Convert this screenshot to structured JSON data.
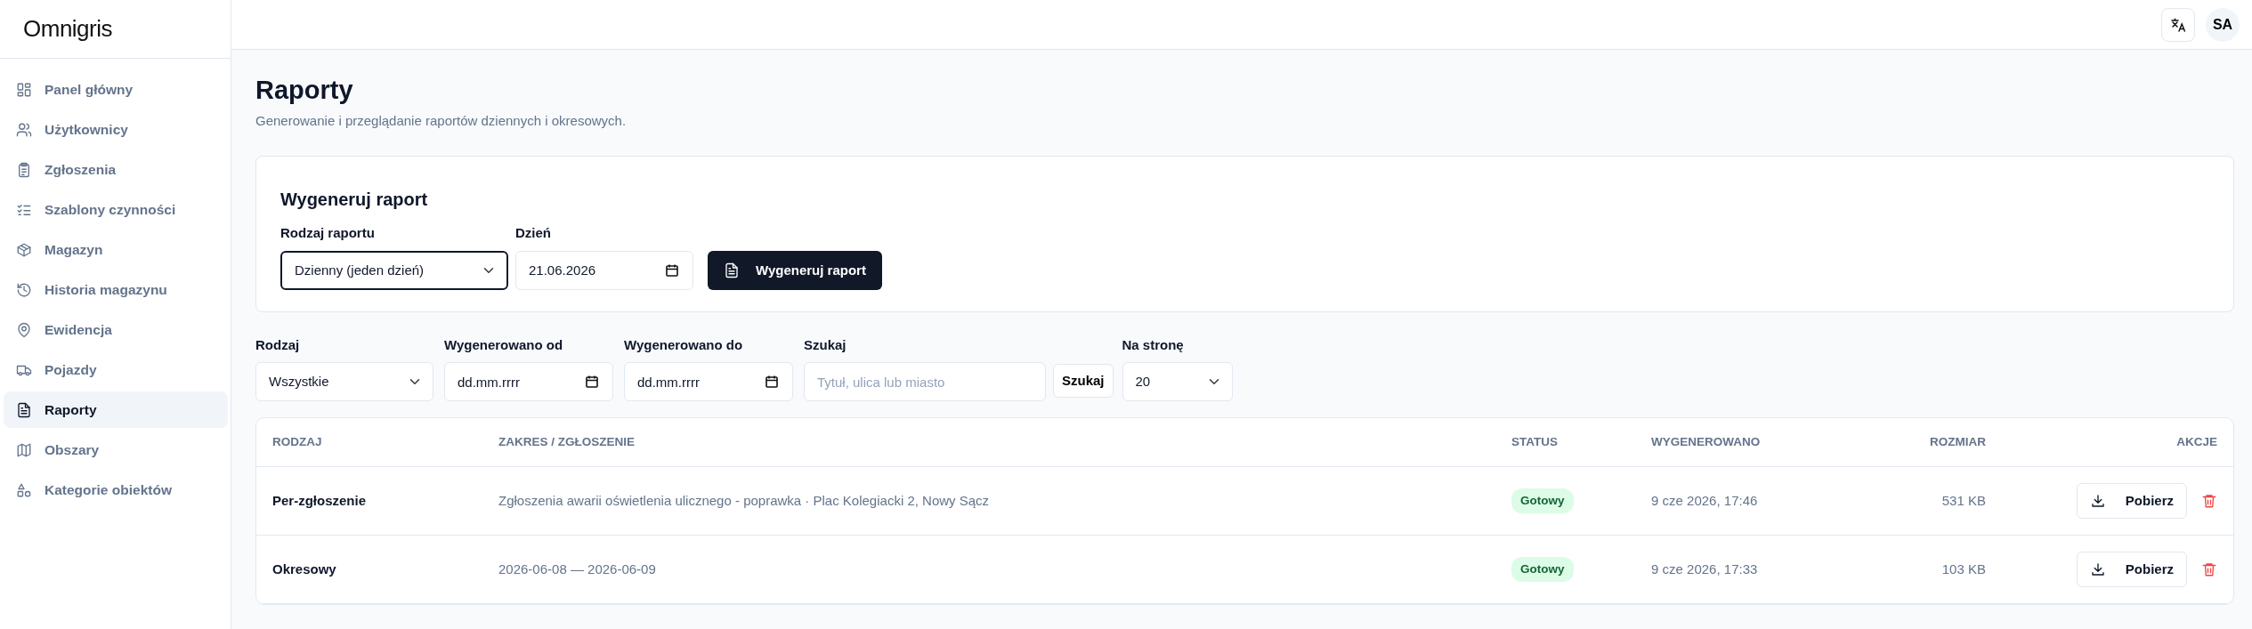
{
  "sidebar": {
    "logo": "Omnigris",
    "items": [
      {
        "label": "Panel główny",
        "selected": false
      },
      {
        "label": "Użytkownicy",
        "selected": false
      },
      {
        "label": "Zgłoszenia",
        "selected": false
      },
      {
        "label": "Szablony czynności",
        "selected": false
      },
      {
        "label": "Magazyn",
        "selected": false
      },
      {
        "label": "Historia magazynu",
        "selected": false
      },
      {
        "label": "Ewidencja",
        "selected": false
      },
      {
        "label": "Pojazdy",
        "selected": false
      },
      {
        "label": "Raporty",
        "selected": true
      },
      {
        "label": "Obszary",
        "selected": false
      },
      {
        "label": "Kategorie obiektów",
        "selected": false
      }
    ]
  },
  "topbar": {
    "avatar": "SA"
  },
  "page": {
    "title": "Raporty",
    "subtitle": "Generowanie i przeglądanie raportów dziennych i okresowych."
  },
  "generate_card": {
    "title": "Wygeneruj raport",
    "report_type": {
      "label": "Rodzaj raportu",
      "value": "Dzienny (jeden dzień)",
      "focused": true
    },
    "day": {
      "label": "Dzień",
      "value": "21.06.2026"
    },
    "button": "Wygeneruj raport"
  },
  "filters": {
    "type": {
      "label": "Rodzaj",
      "value": "Wszystkie"
    },
    "from": {
      "label": "Wygenerowano od",
      "value": "dd.mm.rrrr"
    },
    "to": {
      "label": "Wygenerowano do",
      "value": "dd.mm.rrrr"
    },
    "search": {
      "label": "Szukaj",
      "placeholder": "Tytuł, ulica lub miasto",
      "button": "Szukaj"
    },
    "per_page": {
      "label": "Na stronę",
      "value": "20"
    }
  },
  "table": {
    "columns": [
      "RODZAJ",
      "ZAKRES / ZGŁOSZENIE",
      "STATUS",
      "WYGENEROWANO",
      "ROZMIAR",
      "AKCJE"
    ],
    "rows": [
      {
        "type": "Per-zgłoszenie",
        "scope": "Zgłoszenia awarii oświetlenia ulicznego - poprawka · Plac Kolegiacki 2, Nowy Sącz",
        "status": "Gotowy",
        "generated": "9 cze 2026, 17:46",
        "size": "531 KB",
        "download": "Pobierz"
      },
      {
        "type": "Okresowy",
        "scope": "2026-06-08 — 2026-06-09",
        "status": "Gotowy",
        "generated": "9 cze 2026, 17:33",
        "size": "103 KB",
        "download": "Pobierz"
      }
    ]
  }
}
